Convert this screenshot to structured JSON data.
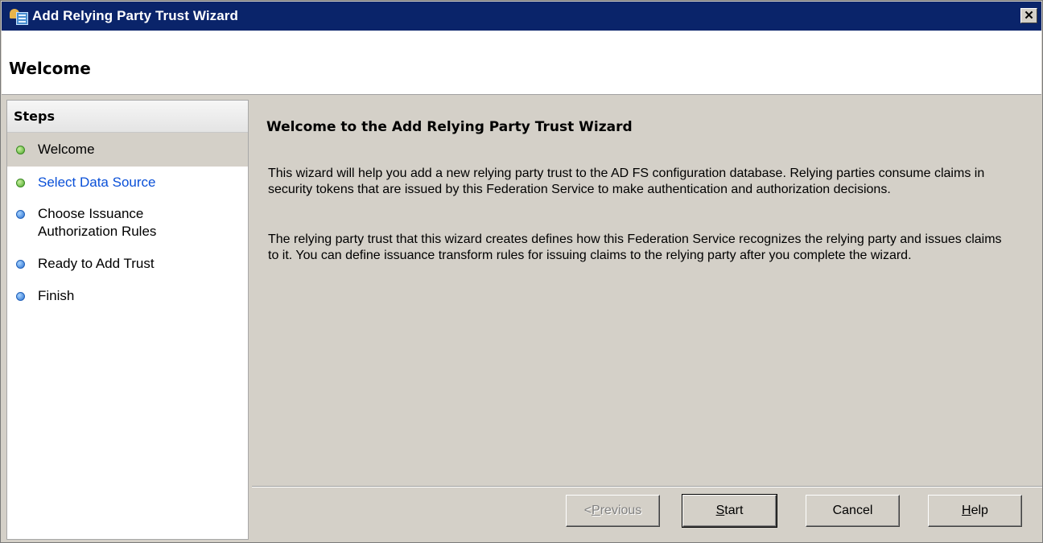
{
  "window": {
    "title": "Add Relying Party Trust Wizard",
    "close_glyph": "✕"
  },
  "header": {
    "title": "Welcome"
  },
  "steps": {
    "heading": "Steps",
    "items": [
      {
        "label": "Welcome",
        "status": "green"
      },
      {
        "label": "Select Data Source",
        "status": "green"
      },
      {
        "label": "Choose Issuance Authorization Rules",
        "line1": "Choose Issuance",
        "line2": "Authorization Rules",
        "status": "blue"
      },
      {
        "label": "Ready to Add Trust",
        "status": "blue"
      },
      {
        "label": "Finish",
        "status": "blue"
      }
    ]
  },
  "main": {
    "heading": "Welcome to the Add Relying Party Trust Wizard",
    "paragraph1": "This wizard will help you add a new relying party trust to the AD FS configuration database.  Relying parties consume claims in security tokens that are issued by this Federation Service to make authentication and authorization decisions.",
    "paragraph2": "The relying party trust that this wizard creates defines how this Federation Service recognizes the relying party and issues claims to it. You can define issuance transform rules for issuing claims to the relying party after you complete the wizard."
  },
  "buttons": {
    "previous": {
      "prefix": "< ",
      "mnemonic": "P",
      "rest": "revious",
      "enabled": false
    },
    "start": {
      "mnemonic": "S",
      "rest": "tart"
    },
    "cancel": {
      "label": "Cancel"
    },
    "help": {
      "mnemonic": "H",
      "rest": "elp"
    }
  },
  "colors": {
    "titlebar": "#0a246a",
    "link": "#0a50d8",
    "step_done": "#4ea82a",
    "step_pending": "#2a70d0"
  }
}
